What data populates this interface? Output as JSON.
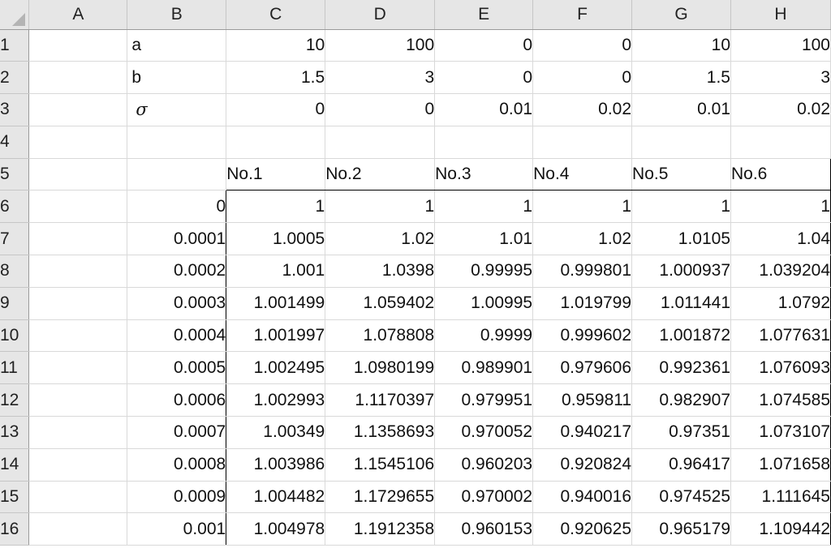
{
  "columns": [
    "A",
    "B",
    "C",
    "D",
    "E",
    "F",
    "G",
    "H"
  ],
  "rows": [
    "1",
    "2",
    "3",
    "4",
    "5",
    "6",
    "7",
    "8",
    "9",
    "10",
    "11",
    "12",
    "13",
    "14",
    "15",
    "16"
  ],
  "params": [
    {
      "label": "a",
      "values": [
        "10",
        "100",
        "0",
        "0",
        "10",
        "100"
      ]
    },
    {
      "label": "b",
      "values": [
        "1.5",
        "3",
        "0",
        "0",
        "1.5",
        "3"
      ]
    },
    {
      "label": "σ",
      "values": [
        "0",
        "0",
        "0.01",
        "0.02",
        "0.01",
        "0.02"
      ]
    }
  ],
  "table_headers": [
    "No.1",
    "No.2",
    "No.3",
    "No.4",
    "No.5",
    "No.6"
  ],
  "data": [
    {
      "t": "0",
      "values": [
        "1",
        "1",
        "1",
        "1",
        "1",
        "1"
      ]
    },
    {
      "t": "0.0001",
      "values": [
        "1.0005",
        "1.02",
        "1.01",
        "1.02",
        "1.0105",
        "1.04"
      ]
    },
    {
      "t": "0.0002",
      "values": [
        "1.001",
        "1.0398",
        "0.99995",
        "0.999801",
        "1.000937",
        "1.039204"
      ]
    },
    {
      "t": "0.0003",
      "values": [
        "1.001499",
        "1.059402",
        "1.00995",
        "1.019799",
        "1.011441",
        "1.0792"
      ]
    },
    {
      "t": "0.0004",
      "values": [
        "1.001997",
        "1.078808",
        "0.9999",
        "0.999602",
        "1.001872",
        "1.077631"
      ]
    },
    {
      "t": "0.0005",
      "values": [
        "1.002495",
        "1.0980199",
        "0.989901",
        "0.979606",
        "0.992361",
        "1.076093"
      ]
    },
    {
      "t": "0.0006",
      "values": [
        "1.002993",
        "1.1170397",
        "0.979951",
        "0.959811",
        "0.982907",
        "1.074585"
      ]
    },
    {
      "t": "0.0007",
      "values": [
        "1.00349",
        "1.1358693",
        "0.970052",
        "0.940217",
        "0.97351",
        "1.073107"
      ]
    },
    {
      "t": "0.0008",
      "values": [
        "1.003986",
        "1.1545106",
        "0.960203",
        "0.920824",
        "0.96417",
        "1.071658"
      ]
    },
    {
      "t": "0.0009",
      "values": [
        "1.004482",
        "1.1729655",
        "0.970002",
        "0.940016",
        "0.974525",
        "1.111645"
      ]
    },
    {
      "t": "0.001",
      "values": [
        "1.004978",
        "1.1912358",
        "0.960153",
        "0.920625",
        "0.965179",
        "1.109442"
      ]
    }
  ]
}
